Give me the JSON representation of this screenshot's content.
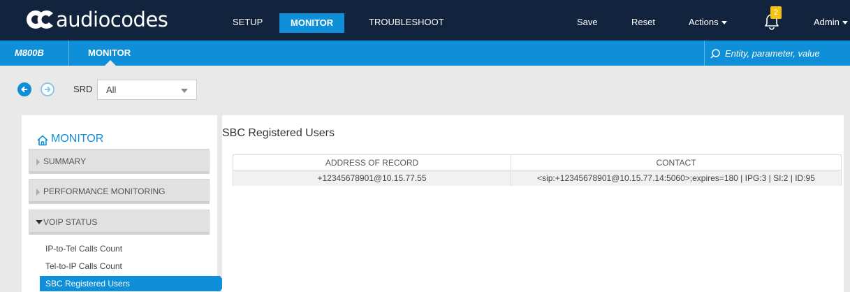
{
  "brand": {
    "name": "audiocodes"
  },
  "topnav": {
    "setup": "SETUP",
    "monitor": "MONITOR",
    "troubleshoot": "TROUBLESHOOT",
    "save": "Save",
    "reset": "Reset",
    "actions": "Actions",
    "notifications_count": "2",
    "user": "Admin"
  },
  "subbar": {
    "device": "M800B",
    "title": "MONITOR",
    "search_placeholder": "Entity, parameter, value"
  },
  "toolbar": {
    "srd_label": "SRD",
    "srd_value": "All"
  },
  "sidebar": {
    "title": "MONITOR",
    "sections": [
      {
        "label": "SUMMARY"
      },
      {
        "label": "PERFORMANCE MONITORING"
      },
      {
        "label": "VOIP STATUS"
      }
    ],
    "links": [
      {
        "label": "IP-to-Tel Calls Count"
      },
      {
        "label": "Tel-to-IP Calls Count"
      },
      {
        "label": "SBC Registered Users"
      }
    ]
  },
  "main": {
    "title": "SBC Registered Users",
    "columns": [
      "ADDRESS OF RECORD",
      "CONTACT"
    ],
    "rows": [
      [
        "+12345678901@10.15.77.55",
        "<sip:+12345678901@10.15.77.14:5060>;expires=180 | IPG:3 | SI:2 | ID:95"
      ]
    ]
  },
  "colors": {
    "topbar": "#12243d",
    "accent": "#0e8fd8",
    "badge": "#f5c211"
  }
}
